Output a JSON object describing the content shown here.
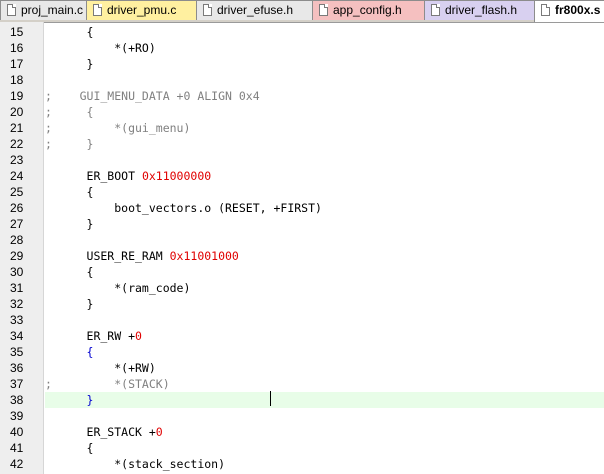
{
  "tabs": [
    {
      "label": "proj_main.c",
      "color": "#e8e8e8",
      "active": false,
      "icon": "file-icon"
    },
    {
      "label": "driver_pmu.c",
      "color": "#fff0a0",
      "active": false,
      "icon": "file-icon"
    },
    {
      "label": "driver_efuse.h",
      "color": "#e8e8e8",
      "active": false,
      "icon": "file-icon"
    },
    {
      "label": "app_config.h",
      "color": "#f5c0c0",
      "active": false,
      "icon": "file-icon"
    },
    {
      "label": "driver_flash.h",
      "color": "#d8d0f0",
      "active": false,
      "icon": "file-icon"
    },
    {
      "label": "fr800x.s",
      "color": "#ffffff",
      "active": true,
      "icon": "file-icon"
    }
  ],
  "editor": {
    "current_line": 38,
    "lines": [
      {
        "num": "15",
        "tokens": [
          {
            "t": "      {",
            "k": "normal"
          }
        ]
      },
      {
        "num": "16",
        "tokens": [
          {
            "t": "          *(+RO)",
            "k": "normal"
          }
        ]
      },
      {
        "num": "17",
        "tokens": [
          {
            "t": "      }",
            "k": "normal"
          }
        ]
      },
      {
        "num": "18",
        "tokens": []
      },
      {
        "num": "19",
        "tokens": [
          {
            "t": ";    GUI_MENU_DATA +0 ALIGN 0x4",
            "k": "comment"
          }
        ]
      },
      {
        "num": "20",
        "tokens": [
          {
            "t": ";     {",
            "k": "comment"
          }
        ]
      },
      {
        "num": "21",
        "tokens": [
          {
            "t": ";         *(gui_menu)",
            "k": "comment"
          }
        ]
      },
      {
        "num": "22",
        "tokens": [
          {
            "t": ";     }",
            "k": "comment"
          }
        ]
      },
      {
        "num": "23",
        "tokens": []
      },
      {
        "num": "24",
        "tokens": [
          {
            "t": "      ER_BOOT ",
            "k": "normal"
          },
          {
            "t": "0x11000000",
            "k": "number"
          }
        ]
      },
      {
        "num": "25",
        "tokens": [
          {
            "t": "      {",
            "k": "normal"
          }
        ]
      },
      {
        "num": "26",
        "tokens": [
          {
            "t": "          boot_vectors.o (RESET, +FIRST)",
            "k": "normal"
          }
        ]
      },
      {
        "num": "27",
        "tokens": [
          {
            "t": "      }",
            "k": "normal"
          }
        ]
      },
      {
        "num": "28",
        "tokens": []
      },
      {
        "num": "29",
        "tokens": [
          {
            "t": "      USER_RE_RAM ",
            "k": "normal"
          },
          {
            "t": "0x11001000",
            "k": "number"
          }
        ]
      },
      {
        "num": "30",
        "tokens": [
          {
            "t": "      {",
            "k": "normal"
          }
        ]
      },
      {
        "num": "31",
        "tokens": [
          {
            "t": "          *(ram_code)",
            "k": "normal"
          }
        ]
      },
      {
        "num": "32",
        "tokens": [
          {
            "t": "      }",
            "k": "normal"
          }
        ]
      },
      {
        "num": "33",
        "tokens": []
      },
      {
        "num": "34",
        "tokens": [
          {
            "t": "      ER_RW +",
            "k": "normal"
          },
          {
            "t": "0",
            "k": "number"
          }
        ]
      },
      {
        "num": "35",
        "tokens": [
          {
            "t": "      {",
            "k": "brace-blue"
          }
        ]
      },
      {
        "num": "36",
        "tokens": [
          {
            "t": "          *(+RW)",
            "k": "normal"
          }
        ]
      },
      {
        "num": "37",
        "tokens": [
          {
            "t": ";         *(STACK)",
            "k": "comment"
          }
        ]
      },
      {
        "num": "38",
        "tokens": [
          {
            "t": "      }",
            "k": "brace-blue"
          }
        ]
      },
      {
        "num": "39",
        "tokens": []
      },
      {
        "num": "40",
        "tokens": [
          {
            "t": "      ER_STACK +",
            "k": "normal"
          },
          {
            "t": "0",
            "k": "number"
          }
        ]
      },
      {
        "num": "41",
        "tokens": [
          {
            "t": "      {",
            "k": "normal"
          }
        ]
      },
      {
        "num": "42",
        "tokens": [
          {
            "t": "          *(stack_section)",
            "k": "normal"
          }
        ]
      }
    ]
  }
}
